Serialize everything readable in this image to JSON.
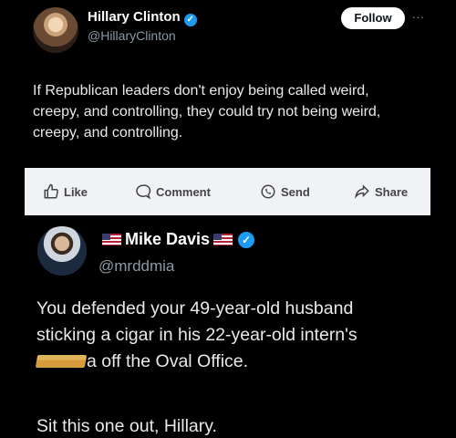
{
  "post1": {
    "author_name": "Hillary Clinton",
    "author_handle": "@HillaryClinton",
    "follow_label": "Follow",
    "more_label": "...",
    "text": "If Republican leaders don't enjoy being called weird, creepy, and controlling, they could try not being weird, creepy, and controlling."
  },
  "actions": {
    "like": "Like",
    "comment": "Comment",
    "send": "Send",
    "share": "Share"
  },
  "post2": {
    "author_name": "Mike Davis",
    "author_handle": "@mrddmia",
    "text_line1": "You defended your 49-year-old husband",
    "text_line2": "sticking a cigar in his 22-year-old intern's",
    "text_line3_suffix": "a off the Oval Office.",
    "closing": "Sit this one out, Hillary."
  },
  "colors": {
    "background": "#000000",
    "verified_badge": "#1d9bf0",
    "action_bar": "#f0f2f5"
  }
}
